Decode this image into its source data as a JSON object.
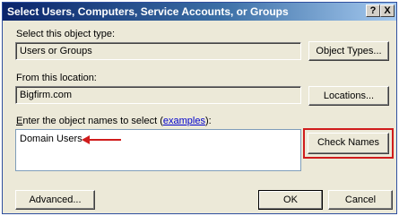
{
  "window": {
    "title": "Select Users, Computers, Service Accounts, or Groups",
    "help_label": "?",
    "close_label": "X"
  },
  "object_type": {
    "label": "Select this object type:",
    "value": "Users or Groups",
    "button_label": "Object Types..."
  },
  "location": {
    "label": "From this location:",
    "value": "Bigfirm.com",
    "button_label": "Locations..."
  },
  "names": {
    "label_accel": "E",
    "label_rest": "nter the object names to select (",
    "link_label": "examples",
    "label_end": "):",
    "value": "Domain Users",
    "check_button_label": "Check Names",
    "highlight_color": "#d01c1c"
  },
  "footer": {
    "advanced_label": "Advanced...",
    "ok_label": "OK",
    "cancel_label": "Cancel"
  }
}
